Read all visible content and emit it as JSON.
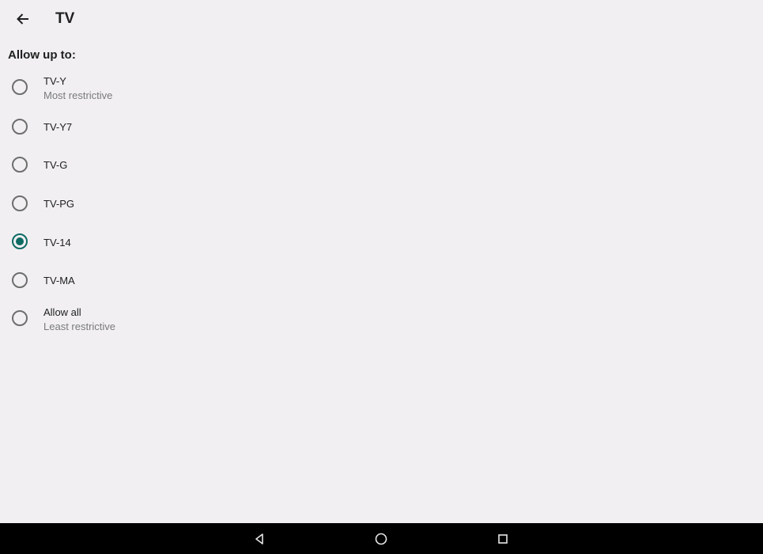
{
  "header": {
    "title": "TV",
    "back_icon": "arrow-left-icon"
  },
  "section_label": "Allow up to:",
  "options": [
    {
      "label": "TV-Y",
      "sublabel": "Most restrictive",
      "checked": false
    },
    {
      "label": "TV-Y7",
      "sublabel": "",
      "checked": false
    },
    {
      "label": "TV-G",
      "sublabel": "",
      "checked": false
    },
    {
      "label": "TV-PG",
      "sublabel": "",
      "checked": false
    },
    {
      "label": "TV-14",
      "sublabel": "",
      "checked": true
    },
    {
      "label": "TV-MA",
      "sublabel": "",
      "checked": false
    },
    {
      "label": "Allow all",
      "sublabel": "Least restrictive",
      "checked": false
    }
  ],
  "colors": {
    "accent": "#0e6b64",
    "background": "#f1eff2",
    "navbar": "#000000"
  },
  "navbar": {
    "back": "nav-back-icon",
    "home": "nav-home-icon",
    "recents": "nav-recents-icon"
  }
}
